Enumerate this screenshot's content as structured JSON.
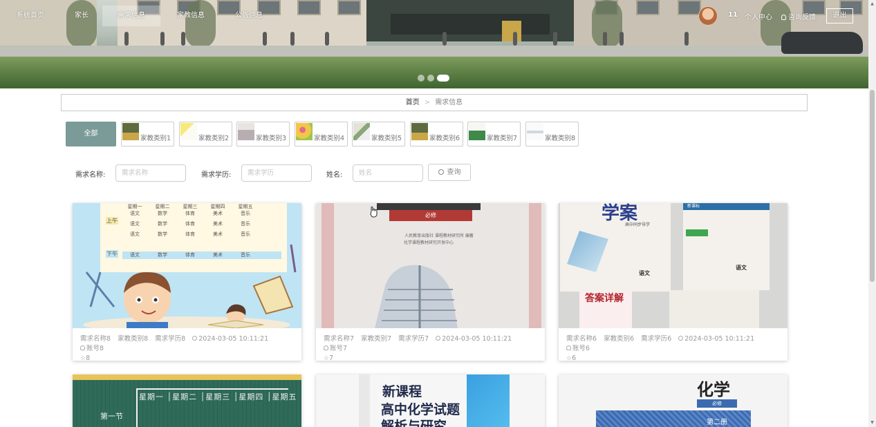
{
  "nav": {
    "items": [
      {
        "label": "系统首页"
      },
      {
        "label": "家长"
      },
      {
        "label": "需求信息"
      },
      {
        "label": "家教信息"
      },
      {
        "label": "公告信息"
      }
    ],
    "active_index": 2,
    "user": "11",
    "profile": "个人中心",
    "feedback": "咨询反馈",
    "logout": "退出"
  },
  "breadcrumb": {
    "home": "首页",
    "separator": ">",
    "current": "需求信息"
  },
  "categories": {
    "all_label": "全部",
    "items": [
      {
        "label": "家教类别1"
      },
      {
        "label": "家教类别2"
      },
      {
        "label": "家教类别3"
      },
      {
        "label": "家教类别4"
      },
      {
        "label": "家教类别5"
      },
      {
        "label": "家教类别6"
      },
      {
        "label": "家教类别7"
      },
      {
        "label": "家教类别8"
      }
    ]
  },
  "search": {
    "name_label": "需求名称:",
    "name_placeholder": "需求名称",
    "edu_label": "需求学历:",
    "edu_placeholder": "需求学历",
    "person_label": "姓名:",
    "person_placeholder": "姓名",
    "button": "查询"
  },
  "cards": [
    {
      "name": "需求名称8",
      "category": "家教类别8",
      "edu": "需求学历8",
      "time": "2024-03-05 10:11:21",
      "account": "账号8",
      "favorites": "8"
    },
    {
      "name": "需求名称7",
      "category": "家教类别7",
      "edu": "需求学历7",
      "time": "2024-03-05 10:11:21",
      "account": "账号7",
      "favorites": "7"
    },
    {
      "name": "需求名称6",
      "category": "家教类别6",
      "edu": "需求学历6",
      "time": "2024-03-05 10:11:21",
      "account": "账号6",
      "favorites": "6"
    }
  ],
  "illustrations": {
    "timetable_headers": [
      "星期一",
      "星期二",
      "星期三",
      "星期四",
      "星期五"
    ],
    "timetable_rows": [
      [
        "语文",
        "数学",
        "体育",
        "美术",
        "音乐"
      ],
      [
        "语文",
        "数学",
        "体育",
        "美术",
        "音乐"
      ],
      [
        "语文",
        "数学",
        "体育",
        "美术",
        "音乐"
      ],
      [
        "语文",
        "数学",
        "体育",
        "美术",
        "音乐"
      ]
    ],
    "timetable_side": [
      "上午",
      "下午"
    ],
    "book7_subtitle": "必修",
    "book7_publisher": "人民教育出版社 课程教材研究所 编著",
    "book7_publisher2": "化学课程教材研究开发中心",
    "book6_left_title": "学案",
    "book6_left_sub": "高中同步导学",
    "book6_left_bottom": "语文",
    "book6_right_header": "新课标",
    "book6_right_bottom": "语文",
    "book6_bottom": "答案详解",
    "card4_headers": [
      "星期一",
      "星期二",
      "星期三",
      "星期四",
      "星期五"
    ],
    "card4_row": "第一节",
    "card5_title1": "新课程",
    "card5_title2": "高中化学试题",
    "card5_title3": "解析与研究",
    "card6_title": "化学",
    "card6_sub": "必修",
    "card6_vol": "第二册"
  }
}
